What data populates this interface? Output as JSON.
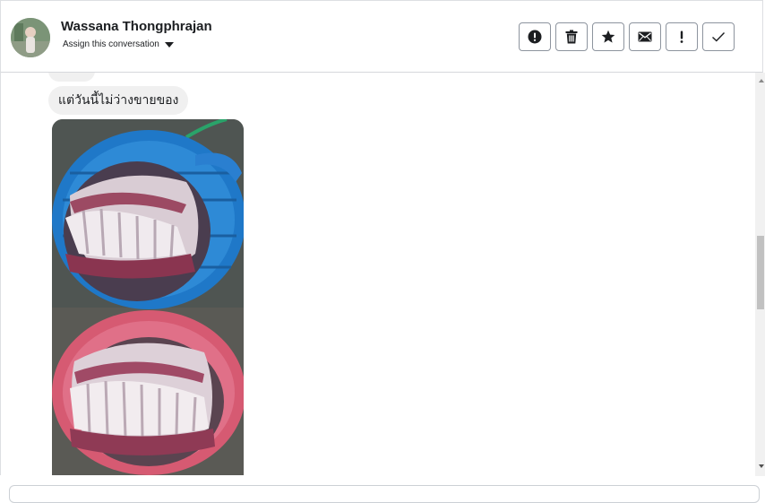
{
  "header": {
    "contact_name": "Wassana Thongphrajan",
    "assign_label": "Assign this conversation",
    "actions": [
      {
        "icon": "alert-circle-icon",
        "name": "mark-as-spam-button"
      },
      {
        "icon": "trash-icon",
        "name": "delete-button"
      },
      {
        "icon": "star-icon",
        "name": "star-button"
      },
      {
        "icon": "envelope-icon",
        "name": "mark-unread-button"
      },
      {
        "icon": "exclamation-icon",
        "name": "follow-up-button"
      },
      {
        "icon": "checkmark-icon",
        "name": "mark-done-button"
      }
    ]
  },
  "thread": {
    "messages": [
      {
        "type": "text",
        "text": "แต่วันนี้ไม่ว่างขายของ"
      },
      {
        "type": "image",
        "subject": "pork-ribs-in-baskets"
      }
    ]
  },
  "colors": {
    "bubble_bg": "#f0f0f0",
    "button_border": "#8d949e",
    "text": "#1c1e21"
  }
}
